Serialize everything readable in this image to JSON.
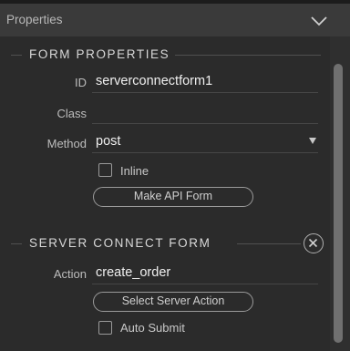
{
  "panel": {
    "title": "Properties"
  },
  "form_properties": {
    "section_title": "FORM PROPERTIES",
    "id_label": "ID",
    "id_value": "serverconnectform1",
    "class_label": "Class",
    "class_value": "",
    "method_label": "Method",
    "method_value": "post",
    "inline_label": "Inline",
    "inline_checked": false,
    "make_api_label": "Make API Form"
  },
  "server_connect": {
    "section_title": "SERVER CONNECT FORM",
    "action_label": "Action",
    "action_value": "create_order",
    "select_action_label": "Select Server Action",
    "auto_submit_label": "Auto Submit",
    "auto_submit_checked": false
  },
  "icons": {
    "collapse": "chevron-down-icon",
    "remove": "close-icon"
  }
}
